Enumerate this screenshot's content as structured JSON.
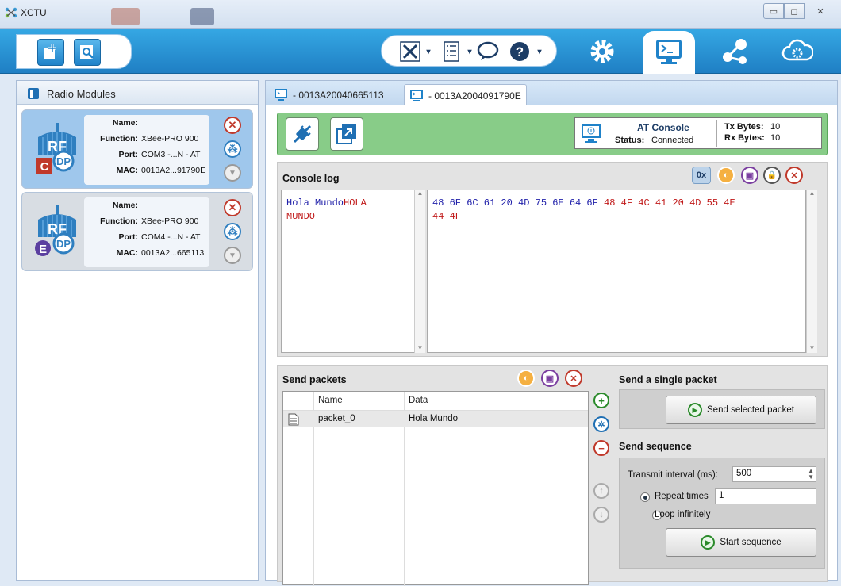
{
  "app": {
    "title": "XCTU"
  },
  "radio_modules": {
    "title": "Radio Modules",
    "items": [
      {
        "name_label": "Name:",
        "name": "",
        "function_label": "Function:",
        "function": "XBee-PRO 900",
        "port_label": "Port:",
        "port": "COM3 -...N - AT",
        "mac_label": "MAC:",
        "mac": "0013A2...91790E",
        "badge": "C",
        "selected": true
      },
      {
        "name_label": "Name:",
        "name": "",
        "function_label": "Function:",
        "function": "XBee-PRO 900",
        "port_label": "Port:",
        "port": "COM4 -...N - AT",
        "mac_label": "MAC:",
        "mac": "0013A2...665113",
        "badge": "E",
        "selected": false
      }
    ]
  },
  "tabs": [
    {
      "label": "- 0013A20040665113"
    },
    {
      "label": "- 0013A2004091790E",
      "active": true
    }
  ],
  "console": {
    "mode_label": "AT Console",
    "status_label": "Status:",
    "status": "Connected",
    "tx_label": "Tx Bytes:",
    "tx": "10",
    "rx_label": "Rx Bytes:",
    "rx": "10",
    "log_title": "Console log",
    "hex_toggle": "0x",
    "log_sent": "Hola Mundo",
    "log_recv_1": "HOLA",
    "log_recv_2": "MUNDO",
    "hex_sent": "48 6F 6C 61 20 4D 75 6E 64 6F",
    "hex_recv_1": "48 4F 4C 41 20 4D 55 4E",
    "hex_recv_2": "44 4F"
  },
  "send_packets": {
    "title": "Send packets",
    "columns": [
      "Name",
      "Data"
    ],
    "rows": [
      {
        "name": "packet_0",
        "data": "Hola Mundo"
      }
    ]
  },
  "single": {
    "title": "Send a single packet",
    "button": "Send selected packet"
  },
  "sequence": {
    "title": "Send sequence",
    "interval_label": "Transmit interval (ms):",
    "interval": "500",
    "repeat_label": "Repeat times",
    "repeat": "1",
    "loop_label": "Loop infinitely",
    "button": "Start sequence"
  },
  "colors": {
    "accent": "#2a93d5",
    "green_bar": "#88cc88",
    "sent_text": "#2222aa",
    "recv_text": "#c01818"
  }
}
